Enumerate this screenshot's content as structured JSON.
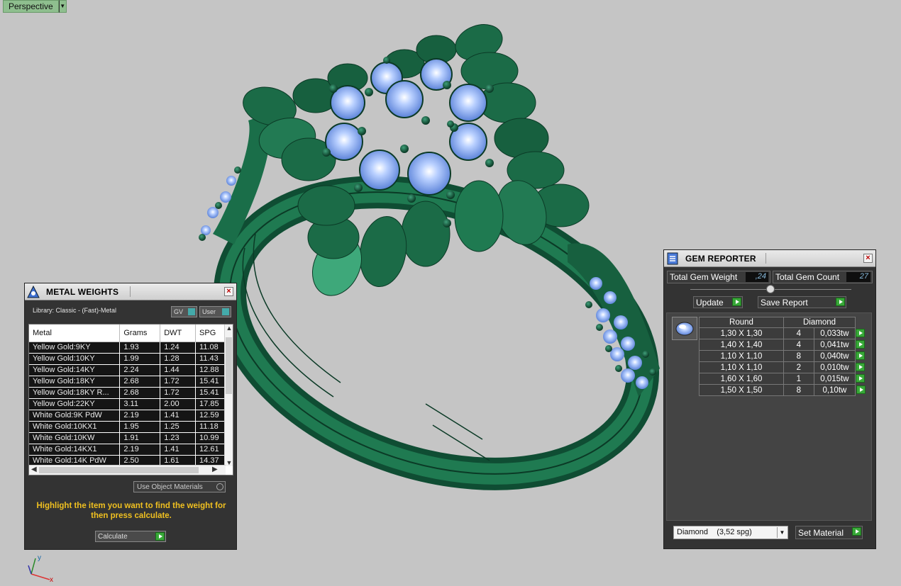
{
  "viewport": {
    "label": "Perspective",
    "dropdown_icon": "chevron-down-icon"
  },
  "metal_weights": {
    "title": "METAL WEIGHTS",
    "library": "Library: Classic - (Fast)-Metal",
    "gv_label": "GV",
    "user_label": "User",
    "columns": [
      "Metal",
      "Grams",
      "DWT",
      "SPG"
    ],
    "rows": [
      [
        "Yellow Gold:9KY",
        "1.93",
        "1.24",
        "11.08"
      ],
      [
        "Yellow Gold:10KY",
        "1.99",
        "1.28",
        "11.43"
      ],
      [
        "Yellow Gold:14KY",
        "2.24",
        "1.44",
        "12.88"
      ],
      [
        "Yellow Gold:18KY",
        "2.68",
        "1.72",
        "15.41"
      ],
      [
        "Yellow Gold:18KY R...",
        "2.68",
        "1.72",
        "15.41"
      ],
      [
        "Yellow Gold:22KY",
        "3.11",
        "2.00",
        "17.85"
      ],
      [
        "White Gold:9K PdW",
        "2.19",
        "1.41",
        "12.59"
      ],
      [
        "White Gold:10KX1",
        "1.95",
        "1.25",
        "11.18"
      ],
      [
        "White Gold:10KW",
        "1.91",
        "1.23",
        "10.99"
      ],
      [
        "White Gold:14KX1",
        "2.19",
        "1.41",
        "12.61"
      ],
      [
        "White Gold:14K PdW",
        "2.50",
        "1.61",
        "14.37"
      ]
    ],
    "use_object_materials": "Use Object Materials",
    "hint": "Highlight the item you want to find the weight for then press calculate.",
    "calculate_label": "Calculate"
  },
  "gem_reporter": {
    "title": "GEM REPORTER",
    "total_weight_label": "Total Gem Weight",
    "total_weight_value": ",24",
    "total_count_label": "Total Gem Count",
    "total_count_value": "27",
    "update_label": "Update",
    "save_report_label": "Save Report",
    "shape_header": "Round",
    "material_header": "Diamond",
    "rows": [
      [
        "1,30 X 1,30",
        "4",
        "0,033tw"
      ],
      [
        "1,40 X 1,40",
        "4",
        "0,041tw"
      ],
      [
        "1,10 X 1,10",
        "8",
        "0,040tw"
      ],
      [
        "1,10 X 1,10",
        "2",
        "0,010tw"
      ],
      [
        "1,60 X 1,60",
        "1",
        "0,015tw"
      ],
      [
        "1,50 X 1,50",
        "8",
        "0,10tw"
      ]
    ],
    "material_select": "Diamond    (3,52 spg)",
    "set_material_label": "Set Material"
  },
  "axes": {
    "x": "x",
    "y": "y"
  },
  "colors": {
    "metal": "#1b6b47",
    "gem": "#8fb4f5",
    "background": "#c5c5c5"
  }
}
